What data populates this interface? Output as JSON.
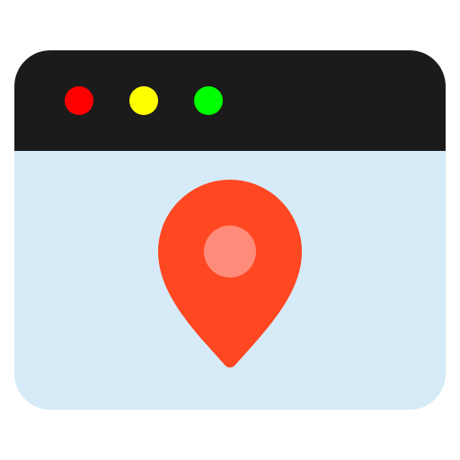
{
  "icon": {
    "name": "browser-location-icon",
    "window": {
      "titlebar_color": "#1b1b1b",
      "content_color": "#d6ebf7",
      "controls": [
        {
          "name": "close-dot",
          "color": "#ff0000"
        },
        {
          "name": "minimize-dot",
          "color": "#ffff00"
        },
        {
          "name": "maximize-dot",
          "color": "#00ff00"
        }
      ]
    },
    "marker": {
      "name": "map-pin-icon",
      "color": "#ff4722",
      "center_color": "#ff8c7a"
    }
  }
}
